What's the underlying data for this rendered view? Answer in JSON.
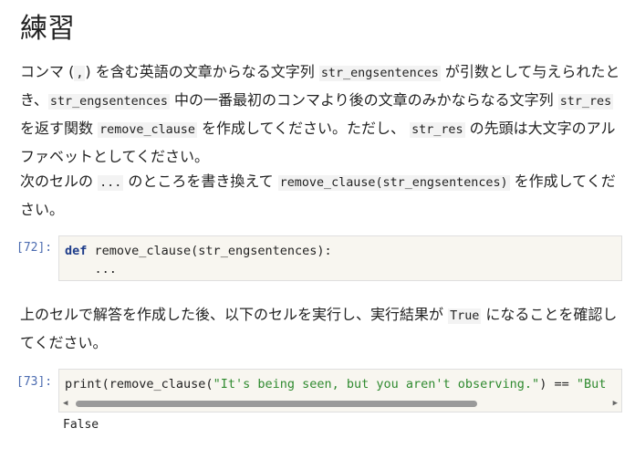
{
  "heading": "練習",
  "p1": {
    "t1": "コンマ (",
    "c1": ",",
    "t2": ") を含む英語の文章からなる文字列 ",
    "c2": "str_engsentences",
    "t3": " が引数として与えられたとき、",
    "c3": "str_engsentences",
    "t4": " 中の一番最初のコンマより後の文章のみかならなる文字列 ",
    "c4": "str_res",
    "t5": " を返す関数 ",
    "c5": "remove_clause",
    "t6": " を作成してください。ただし、 ",
    "c6": "str_res",
    "t7": " の先頭は大文字のアルファベットとしてください。"
  },
  "p2": {
    "t1": "次のセルの ",
    "c1": "...",
    "t2": " のところを書き換えて ",
    "c2": "remove_clause(str_engsentences)",
    "t3": " を作成してください。"
  },
  "cell1": {
    "prompt": "[72]:",
    "kw": "def",
    "line1_rest": " remove_clause(str_engsentences):",
    "line2": "    ..."
  },
  "p3": {
    "t1": "上のセルで解答を作成した後、以下のセルを実行し、実行結果が ",
    "c1": "True",
    "t2": " になることを確認してください。"
  },
  "cell2": {
    "prompt": "[73]:",
    "code_a": "print(remove_clause(",
    "str1": "\"It's being seen, but you aren't observing.\"",
    "code_b": ") == ",
    "str2": "\"But",
    "left_arrow": "◀",
    "right_arrow": "▶"
  },
  "output": "False"
}
